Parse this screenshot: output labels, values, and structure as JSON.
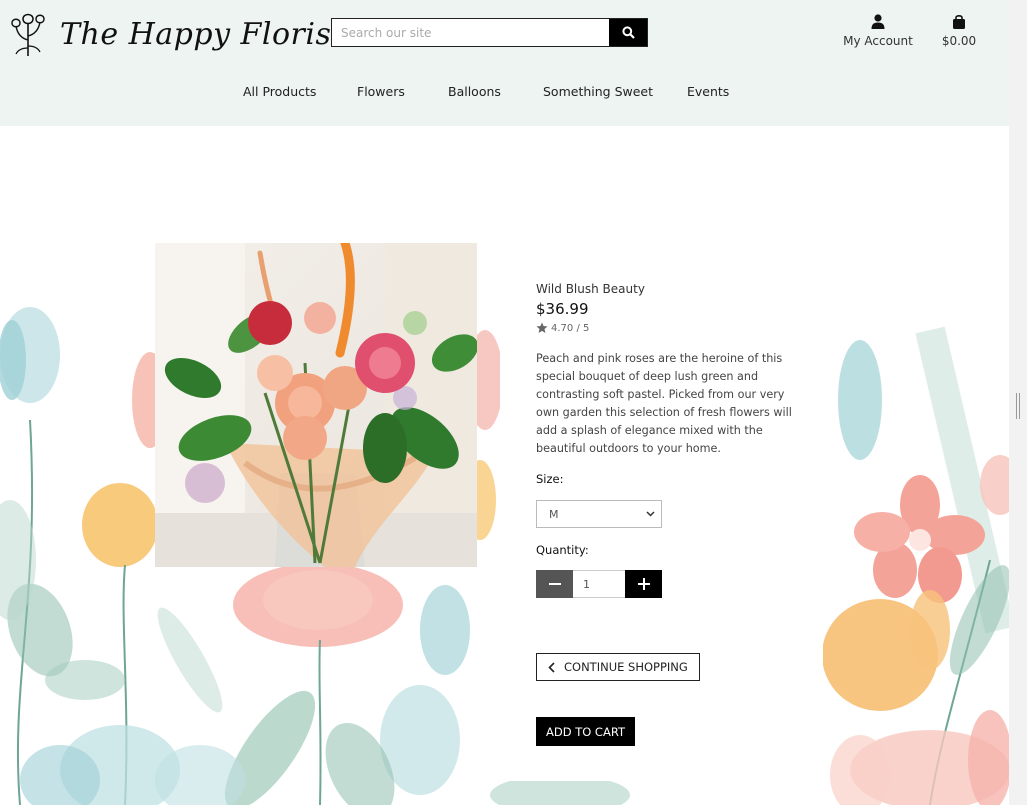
{
  "header": {
    "logo_text": "The Happy Florist",
    "search": {
      "placeholder": "Search our site"
    },
    "account_label": "My Account",
    "cart_total": "$0.00"
  },
  "nav": {
    "items": [
      {
        "label": "All Products"
      },
      {
        "label": "Flowers"
      },
      {
        "label": "Balloons"
      },
      {
        "label": "Something Sweet"
      },
      {
        "label": "Events"
      }
    ]
  },
  "product": {
    "title": "Wild Blush Beauty",
    "price": "$36.99",
    "rating": "4.70 / 5",
    "description": "Peach and pink roses are the heroine of this special bouquet of deep lush green and contrasting soft pastel. Picked from our very own garden this selection of fresh flowers will add a splash of elegance mixed with the beautiful outdoors to your home.",
    "size_label": "Size:",
    "size_selected": "M",
    "quantity_label": "Quantity:",
    "quantity_value": "1"
  },
  "actions": {
    "continue_label": "CONTINUE SHOPPING",
    "add_to_cart_label": "ADD TO CART"
  },
  "colors": {
    "header_bg": "#edf4f1",
    "button_dark": "#000000",
    "qty_minus": "#555555"
  }
}
